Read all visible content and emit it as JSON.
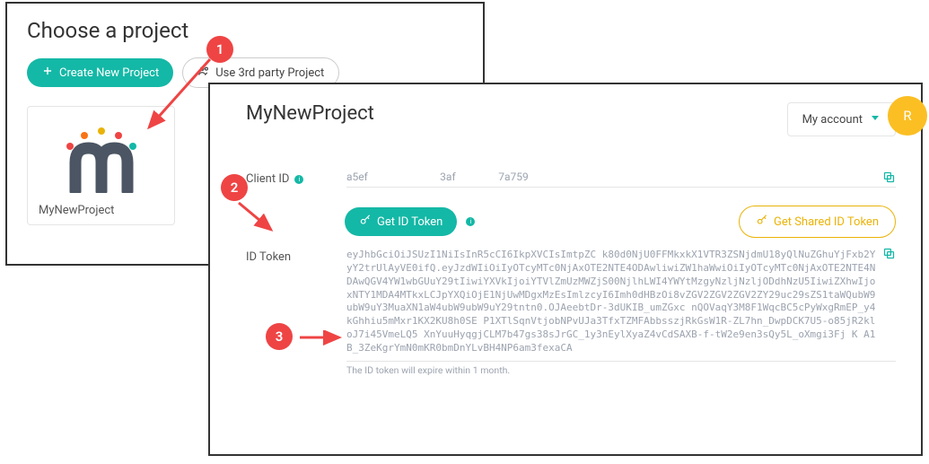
{
  "panelA": {
    "title": "Choose a project",
    "createBtn": "Create New Project",
    "thirdPartyBtn": "Use 3rd party Project",
    "projectCard": {
      "name": "MyNewProject"
    }
  },
  "panelB": {
    "title": "MyNewProject",
    "account": {
      "label": "My account"
    },
    "avatarLetter": "R",
    "clientId": {
      "label": "Client ID",
      "value": "a5ef                           3af                7a759"
    },
    "getTokenBtn": "Get ID Token",
    "sharedTokenBtn": "Get Shared ID Token",
    "idToken": {
      "label": "ID Token",
      "value": "eyJhbGciOiJSUzI1NiIsInR5cCI6IkpXVCIsImtpZC    k80d0NjU0FFMkxkX1VTR3ZSNjdmU18yQlNuZGhuYjFxb2YyY2trUlAyVE0ifQ.eyJzdWIiOiIyOTcyMTc0NjAxOTE2NTE4ODAwliwiZW1haWwiOiIyOTcyMTc0NjAxOTE2NTE4NDAwQGV4YW1wbGUuY29tIiwiYXVkIjoiYTVlZmUzMWZjS00NjlhLWI4YWYtMzgyNzljNzljODdhNzU5IiwiZXhwIjoxNTY1MDA4MTkxLCJpYXQiOjE1NjUwMDgxMzEsImlzcyI6Imh0dHBzOi8vZGV2ZGV2ZGV2ZY29uc29sZS1taWQubW9ubW9uY3MuaXN1aW4ubW9ubW9uY29tntn0.OJAeebtDr-3dUKIB_umZGxc                                                                                   nQOVaqY3M8F1WqcBC5cPyWxgRmEP_y4kGhhiu5mMxr1KX2KU8h0SE          P1XTlSqnVtjobNPvUJa3TfxTZMFAbbsszjRkGsW1R-ZL7hn_DwpDCK7U5-o85jR2kloJ7i45VmeLQ5        XnYuuHyqgjCLM7b47gs38sJrGC_1y3nEylXyaZ4vCdSAXB-f-tW2e9en3sQy5L_oXmgi3Fj                                                                                K A1B_3ZeKgrYmN0mKR0bmDnYLvBH4NP6am3fexaCA",
      "note": "The ID token will expire within 1 month."
    }
  },
  "steps": {
    "s1": "1",
    "s2": "2",
    "s3": "3"
  }
}
